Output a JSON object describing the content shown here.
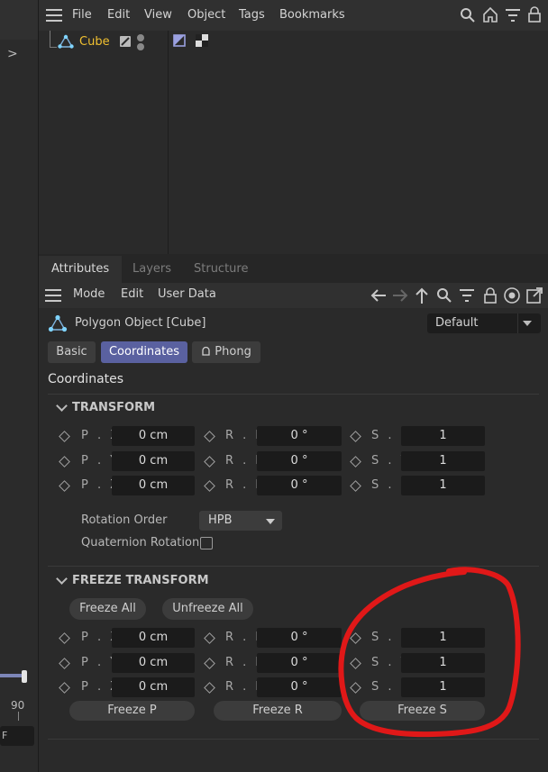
{
  "object_manager": {
    "menu": [
      "File",
      "Edit",
      "View",
      "Object",
      "Tags",
      "Bookmarks"
    ],
    "object_name": "Cube"
  },
  "timeline": {
    "tick_label": "90",
    "field_value": "F"
  },
  "attributes": {
    "tabs": [
      "Attributes",
      "Layers",
      "Structure"
    ],
    "menu": [
      "Mode",
      "Edit",
      "User Data"
    ],
    "object_title": "Polygon Object [Cube]",
    "preset": "Default",
    "subtabs": [
      "Basic",
      "Coordinates",
      "Phong"
    ],
    "section_title": "Coordinates",
    "transform": {
      "header": "TRANSFORM",
      "p_labels": [
        "P . X",
        "P . Y",
        "P . Z"
      ],
      "r_labels": [
        "R . H",
        "R . P",
        "R . B"
      ],
      "s_labels": [
        "S . X",
        "S . Y",
        "S . Z"
      ],
      "p_values": [
        "0 cm",
        "0 cm",
        "0 cm"
      ],
      "r_values": [
        "0 °",
        "0 °",
        "0 °"
      ],
      "s_values": [
        "1",
        "1",
        "1"
      ],
      "rotation_order_label": "Rotation Order",
      "rotation_order_value": "HPB",
      "quaternion_label": "Quaternion Rotation"
    },
    "freeze": {
      "header": "FREEZE TRANSFORM",
      "freeze_all": "Freeze All",
      "unfreeze_all": "Unfreeze All",
      "p_labels": [
        "P . X",
        "P . Y",
        "P . Z"
      ],
      "r_labels": [
        "R . H",
        "R . P",
        "R . B"
      ],
      "s_labels": [
        "S . X",
        "S . Y",
        "S . Z"
      ],
      "p_values": [
        "0 cm",
        "0 cm",
        "0 cm"
      ],
      "r_values": [
        "0 °",
        "0 °",
        "0 °"
      ],
      "s_values": [
        "1",
        "1",
        "1"
      ],
      "freeze_p": "Freeze P",
      "freeze_r": "Freeze R",
      "freeze_s": "Freeze S"
    }
  },
  "colors": {
    "annotation": "#e01818",
    "accent": "#5a61a0",
    "object_name": "#f0c030"
  }
}
